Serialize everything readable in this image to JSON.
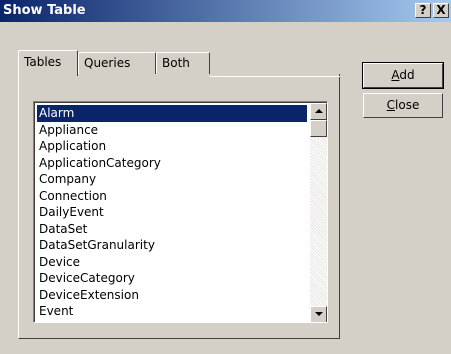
{
  "window": {
    "title": "Show Table",
    "help_glyph": "?",
    "close_glyph": "X"
  },
  "tabs": [
    {
      "label": "Tables",
      "active": true
    },
    {
      "label": "Queries",
      "active": false
    },
    {
      "label": "Both",
      "active": false
    }
  ],
  "list": {
    "selected": "Alarm",
    "items": [
      "Alarm",
      "Appliance",
      "Application",
      "ApplicationCategory",
      "Company",
      "Connection",
      "DailyEvent",
      "DataSet",
      "DataSetGranularity",
      "Device",
      "DeviceCategory",
      "DeviceExtension",
      "Event"
    ]
  },
  "buttons": {
    "add_mnemonic": "A",
    "add_rest": "dd",
    "close_mnemonic": "C",
    "close_rest": "lose"
  },
  "colors": {
    "face": "#d4d0c8",
    "titlebar_start": "#0a246a",
    "titlebar_end": "#a6caf0",
    "selection": "#0a246a"
  }
}
